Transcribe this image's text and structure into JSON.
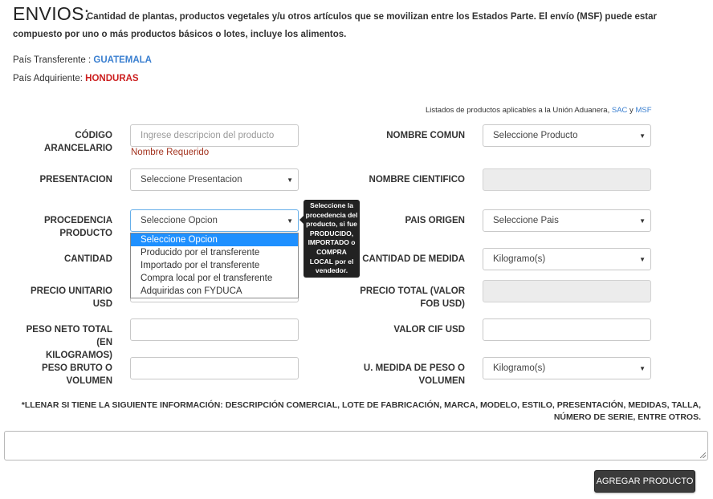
{
  "header": {
    "title": "ENVIOS:",
    "description": "Cantidad de plantas, productos vegetales y/u otros artículos que se movilizan entre los Estados Parte. El envío (MSF) puede estar compuesto por uno o más productos básicos o lotes, incluye los alimentos."
  },
  "countries": {
    "transferente_label": "País Transferente :",
    "transferente_value": "GUATEMALA",
    "adquiriente_label": "País Adquiriente:",
    "adquiriente_value": "HONDURAS"
  },
  "list_note": {
    "text": "Listados de productos aplicables a la Unión Aduanera,",
    "link_sac": "SAC",
    "connector": "y",
    "link_msf": "MSF"
  },
  "form": {
    "codigo_label": "CÓDIGO ARANCELARIO",
    "codigo_placeholder": "Ingrese descripcion del producto",
    "codigo_error": "Nombre Requerido",
    "nombre_comun_label": "NOMBRE COMUN",
    "nombre_comun_value": "Seleccione Producto",
    "presentacion_label": "PRESENTACION",
    "presentacion_value": "Seleccione Presentacion",
    "nombre_cientifico_label": "NOMBRE CIENTIFICO",
    "procedencia_label_1": "PROCEDENCIA",
    "procedencia_label_2": "PRODUCTO",
    "procedencia_value": "Seleccione Opcion",
    "procedencia_options": [
      "Seleccione Opcion",
      "Producido por el transferente",
      "Importado por el transferente",
      "Compra local por el transferente",
      "Adquiridas con FYDUCA"
    ],
    "procedencia_tooltip": "Seleccione la procedencia del producto, si fue PRODUCIDO, IMPORTADO o COMPRA LOCAL por el vendedor.",
    "pais_origen_label": "PAIS ORIGEN",
    "pais_origen_value": "Seleccione Pais",
    "cantidad_label": "CANTIDAD",
    "cantidad_medida_label": "CANTIDAD DE MEDIDA",
    "cantidad_medida_value": "Kilogramo(s)",
    "precio_unitario_label": "PRECIO UNITARIO USD",
    "precio_total_label_1": "PRECIO TOTAL (VALOR",
    "precio_total_label_2": "FOB USD)",
    "peso_neto_label_1": "PESO NETO TOTAL (EN",
    "peso_neto_label_2": "KILOGRAMOS)",
    "valor_cif_label": "VALOR CIF USD",
    "peso_bruto_label_1": "PESO BRUTO O",
    "peso_bruto_label_2": "VOLUMEN",
    "u_medida_label_1": "U. MEDIDA DE PESO O",
    "u_medida_label_2": "VOLUMEN",
    "u_medida_value": "Kilogramo(s)"
  },
  "extra_note": "*LLENAR SI TIENE LA SIGUIENTE INFORMACIÓN: DESCRIPCIÓN COMERCIAL, LOTE DE FABRICACIÓN, MARCA, MODELO, ESTILO, PRESENTACIÓN, MEDIDAS, TALLA, NÚMERO DE SERIE, ENTRE OTROS.",
  "actions": {
    "add_label": "AGREGAR PRODUCTO"
  },
  "icons": {
    "caret": "caret-down-icon",
    "resize": "resize-grip-icon"
  },
  "colors": {
    "link": "#3a7fd0",
    "alert": "#cc1f1f",
    "selected": "#1e90ff",
    "button": "#3b3b3b"
  }
}
